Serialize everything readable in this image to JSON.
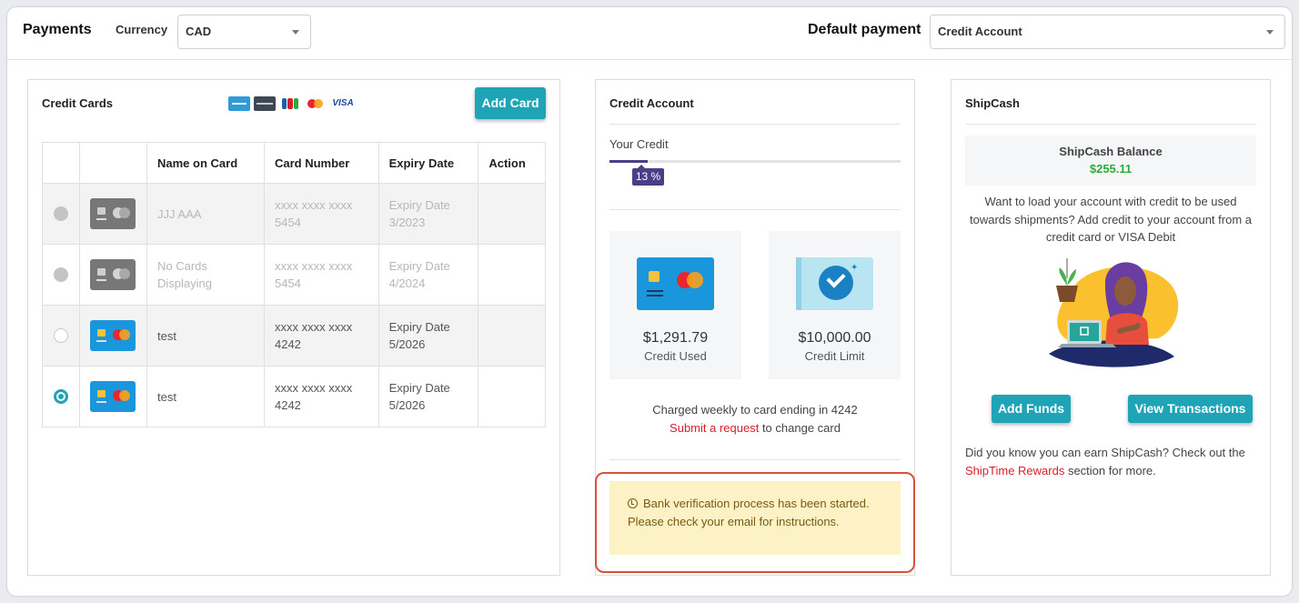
{
  "header": {
    "title": "Payments",
    "currency_label": "Currency",
    "currency_value": "CAD",
    "default_payment_label": "Default payment",
    "default_payment_value": "Credit Account"
  },
  "credit_cards": {
    "title": "Credit Cards",
    "brand_icons": [
      "amex-icon",
      "discover-icon",
      "jcb-icon",
      "mastercard-icon",
      "visa-icon"
    ],
    "visa_text": "VISA",
    "add_button": "Add Card",
    "columns": [
      "",
      "",
      "Name on Card",
      "Card Number",
      "Expiry Date",
      "Action"
    ],
    "rows": [
      {
        "name": "JJJ AAA",
        "number_line1": "xxxx xxxx xxxx",
        "number_line2": "5454",
        "expiry_label": "Expiry Date",
        "expiry": "3/2023",
        "radio": "disabled",
        "card_style": "gray"
      },
      {
        "name_line1": "No Cards",
        "name_line2": "Displaying",
        "number_line1": "xxxx xxxx xxxx",
        "number_line2": "5454",
        "expiry_label": "Expiry Date",
        "expiry": "4/2024",
        "radio": "disabled",
        "card_style": "gray"
      },
      {
        "name": "test",
        "number_line1": "xxxx xxxx xxxx",
        "number_line2": "4242",
        "expiry_label": "Expiry Date",
        "expiry": "5/2026",
        "radio": "unchecked",
        "card_style": "blue"
      },
      {
        "name": "test",
        "number_line1": "xxxx xxxx xxxx",
        "number_line2": "4242",
        "expiry_label": "Expiry Date",
        "expiry": "5/2026",
        "radio": "checked",
        "card_style": "blue"
      }
    ]
  },
  "credit_account": {
    "title": "Credit Account",
    "your_credit_label": "Your Credit",
    "usage_percent": 13,
    "usage_badge": "13 %",
    "credit_used_amount": "$1,291.79",
    "credit_used_label": "Credit Used",
    "credit_limit_amount": "$10,000.00",
    "credit_limit_label": "Credit Limit",
    "charged_text": "Charged weekly to card ending in 4242",
    "submit_link": "Submit a request",
    "change_suffix": " to change card",
    "alert_text": "Bank verification process has been started. Please check your email for instructions."
  },
  "shipcash": {
    "title": "ShipCash",
    "balance_label": "ShipCash Balance",
    "balance_value": "$255.11",
    "load_text": "Want to load your account with credit to be used towards shipments? Add credit to your account from a credit card or VISA Debit",
    "add_funds": "Add Funds",
    "view_transactions": "View Transactions",
    "earn_text": "Did you know you can earn ShipCash? Check out the ",
    "rewards_link": "ShipTime Rewards",
    "earn_suffix": " section for more."
  },
  "colors": {
    "accent": "#1fa3b6",
    "progress": "#4b3d86",
    "link": "#d8202c",
    "balance": "#2eaa3a",
    "alert_bg": "#fdf2c6",
    "highlight": "#d9503f"
  }
}
